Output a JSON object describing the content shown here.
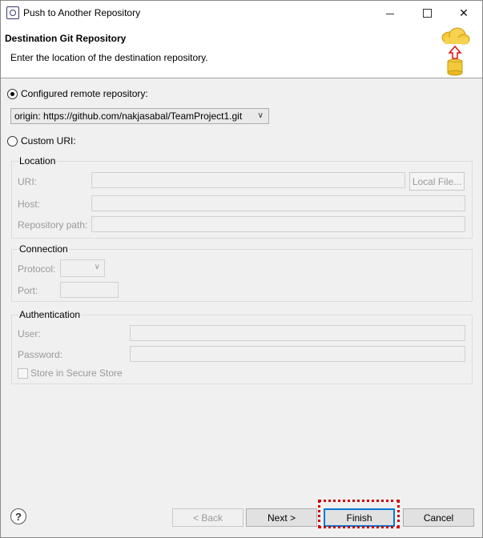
{
  "window": {
    "title": "Push to Another Repository"
  },
  "header": {
    "title": "Destination Git Repository",
    "description": "Enter the location of the destination repository."
  },
  "configured_remote": {
    "label": "Configured remote repository:",
    "selected": true,
    "value": "origin: https://github.com/nakjasabal/TeamProject1.git"
  },
  "custom_uri": {
    "label": "Custom URI:",
    "selected": false
  },
  "location": {
    "group_label": "Location",
    "uri_label": "URI:",
    "uri_value": "",
    "local_file_button": "Local File...",
    "host_label": "Host:",
    "host_value": "",
    "repo_path_label": "Repository path:",
    "repo_path_value": ""
  },
  "connection": {
    "group_label": "Connection",
    "protocol_label": "Protocol:",
    "protocol_value": "",
    "port_label": "Port:",
    "port_value": ""
  },
  "authentication": {
    "group_label": "Authentication",
    "user_label": "User:",
    "user_value": "",
    "password_label": "Password:",
    "password_value": "",
    "store_label": "Store in Secure Store",
    "store_checked": false
  },
  "footer": {
    "help": "?",
    "back": "< Back",
    "next": "Next >",
    "finish": "Finish",
    "cancel": "Cancel"
  },
  "colors": {
    "highlight": "#d00000",
    "focus": "#0078d7"
  }
}
